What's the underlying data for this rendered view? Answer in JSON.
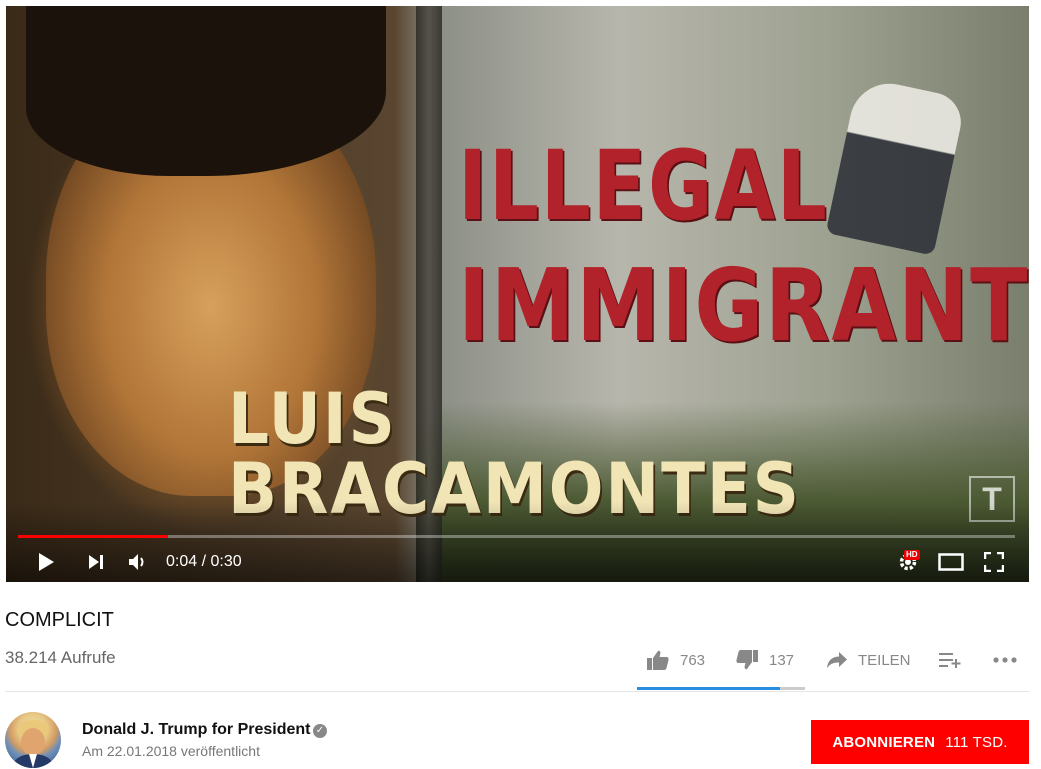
{
  "player": {
    "overlay_text": {
      "line1": "ILLEGAL",
      "line2": "IMMIGRANT",
      "line3": "LUIS BRACAMONTES"
    },
    "watermark": "T",
    "time_current": "0:04",
    "time_separator": " / ",
    "time_total": "0:30",
    "progress_fraction": 0.15,
    "hd_badge": "HD",
    "icons": [
      "play-icon",
      "next-icon",
      "volume-icon",
      "settings-icon",
      "theater-mode-icon",
      "fullscreen-icon"
    ]
  },
  "video": {
    "title": "COMPLICIT",
    "views": "38.214 Aufrufe",
    "likes": "763",
    "dislikes": "137",
    "share_label": "TEILEN",
    "like_fraction": 0.85
  },
  "channel": {
    "name": "Donald J. Trump for President",
    "published": "Am 22.01.2018 veröffentlicht",
    "subscribe_label": "ABONNIEREN",
    "subscriber_count": "111 TSD."
  },
  "colors": {
    "brand_red": "#ff0000",
    "sentiment_blue": "#2a8ee0",
    "overlay_red": "#b1222a",
    "overlay_cream": "#f1e5b6"
  }
}
